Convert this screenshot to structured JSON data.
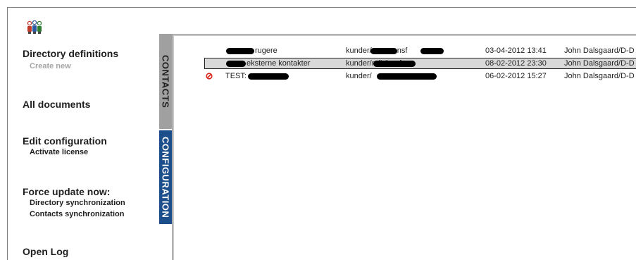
{
  "nav": {
    "directory_definitions": "Directory definitions",
    "create_new": "Create new",
    "all_documents": "All documents",
    "edit_configuration": "Edit configuration",
    "activate_license": "Activate license",
    "force_update": "Force update now:",
    "directory_sync": "Directory synchronization",
    "contacts_sync": "Contacts synchronization",
    "open_log": "Open Log"
  },
  "tabs": {
    "contacts": "CONTACTS",
    "configuration": "CONFIGURATION"
  },
  "directories": [
    {
      "name": "rugere",
      "path": "kunder/names.nsf",
      "date": "03-04-2012 13:41",
      "user": "John Dalsgaard/D-D",
      "status": ""
    },
    {
      "name": "eksterne kontakter",
      "path": "kunder/ndir2.nsf",
      "date": "08-02-2012 23:30",
      "user": "John Dalsgaard/D-D",
      "status": ""
    },
    {
      "name": "TEST:",
      "path": "kunder/",
      "date": "06-02-2012 15:27",
      "user": "John Dalsgaard/D-D",
      "status": "disabled-icon"
    }
  ],
  "colors": {
    "active_tab": "#1b4e8a",
    "inactive_tab": "#a0a0a0",
    "disabled_icon": "#d9261c"
  }
}
